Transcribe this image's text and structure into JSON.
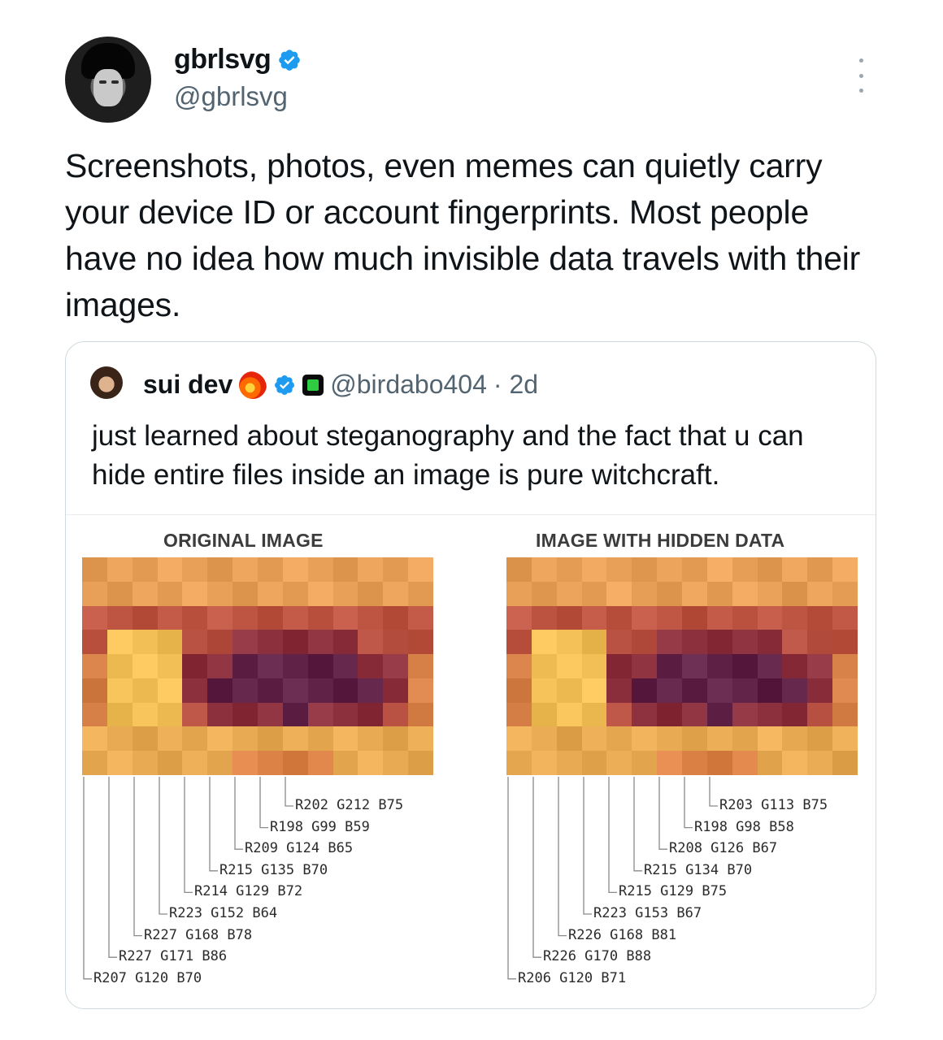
{
  "tweet": {
    "author": {
      "display_name": "gbrlsvg",
      "handle": "@gbrlsvg",
      "verified": true
    },
    "text": "Screenshots, photos, even memes can quietly carry your device ID or account fingerprints. Most people have no idea how much invisible data travels with their images.",
    "menu_icon": "more-vertical-icon"
  },
  "quote": {
    "author": {
      "display_name": "sui dev",
      "handle": "@birdabo404",
      "time": "· 2d",
      "verified": true,
      "emoji": "fire-meteor-icon",
      "badge": "square-app-badge-icon"
    },
    "text": "just learned about steganography and the fact that u can hide entire files inside an image is pure witchcraft.",
    "figure": {
      "left_title": "ORIGINAL IMAGE",
      "right_title": "IMAGE WITH HIDDEN DATA",
      "left_labels": [
        "R202 G212 B75",
        "R198 G99 B59",
        "R209 G124 B65",
        "R215 G135 B70",
        "R214 G129 B72",
        "R223 G152 B64",
        "R227 G168 B78",
        "R227 G171 B86",
        "R207 G120 B70"
      ],
      "right_labels": [
        "R203 G113 B75",
        "R198 G98 B58",
        "R208 G126 B67",
        "R215 G134 B70",
        "R215 G129 B75",
        "R223 G153 B67",
        "R226 G168 B81",
        "R226 G170 B88",
        "R206 G120 B71"
      ]
    }
  },
  "colors": {
    "text": "#0f1419",
    "muted": "#536471",
    "verified_blue": "#1d9bf0",
    "border": "#cfd9de"
  }
}
